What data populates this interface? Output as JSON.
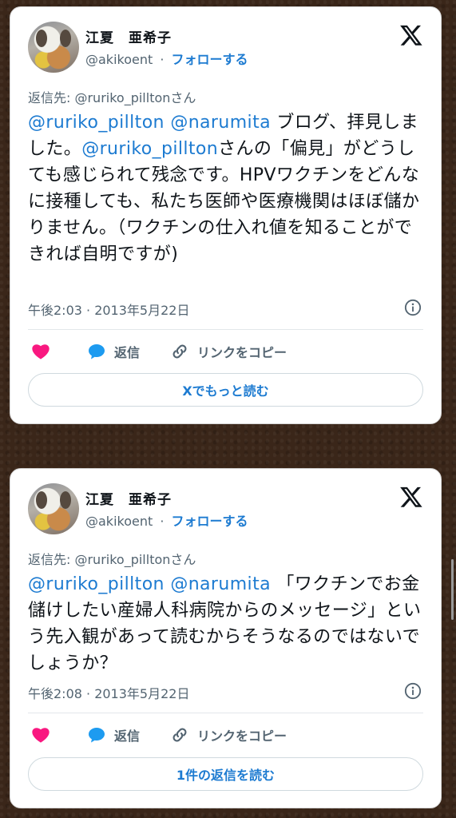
{
  "tweets": [
    {
      "name": "江夏　亜希子",
      "handle": "@akikoent",
      "separator": "·",
      "follow_label": "フォローする",
      "reply_to": "返信先: @ruriko_pilltonさん",
      "mention1": "@ruriko_pillton",
      "mention2": "@narumita",
      "text_part1": " ブログ、拝見しました。",
      "mention3": "@ruriko_pillton",
      "text_part2": "さんの「偏見」がどうしても感じられて残念です。HPVワクチンをどんなに接種しても、私たち医師や医療機関はほぼ儲かりません。（ワクチンの仕入れ値を知ることができれば自明ですが)",
      "timestamp": "午後2:03 · 2013年5月22日",
      "reply_label": "返信",
      "copy_link_label": "リンクをコピー",
      "read_more_label": "Xでもっと読む"
    },
    {
      "name": "江夏　亜希子",
      "handle": "@akikoent",
      "separator": "·",
      "follow_label": "フォローする",
      "reply_to": "返信先: @ruriko_pilltonさん",
      "mention1": "@ruriko_pillton",
      "mention2": "@narumita",
      "text_part1": " 「ワクチンでお金儲けしたい産婦人科病院からのメッセージ」という先入観があって読むからそうなるのではないでしょうか？",
      "timestamp": "午後2:08 · 2013年5月22日",
      "reply_label": "返信",
      "copy_link_label": "リンクをコピー",
      "read_more_label": "1件の返信を読む"
    }
  ],
  "colors": {
    "accent": "#1d7bd1",
    "heart": "#f91880",
    "reply_bubble": "#1d9bf0",
    "secondary_text": "#536471",
    "background": "#3a2619"
  },
  "icons": [
    "x-logo-icon",
    "info-icon",
    "heart-icon",
    "reply-icon",
    "link-icon"
  ]
}
